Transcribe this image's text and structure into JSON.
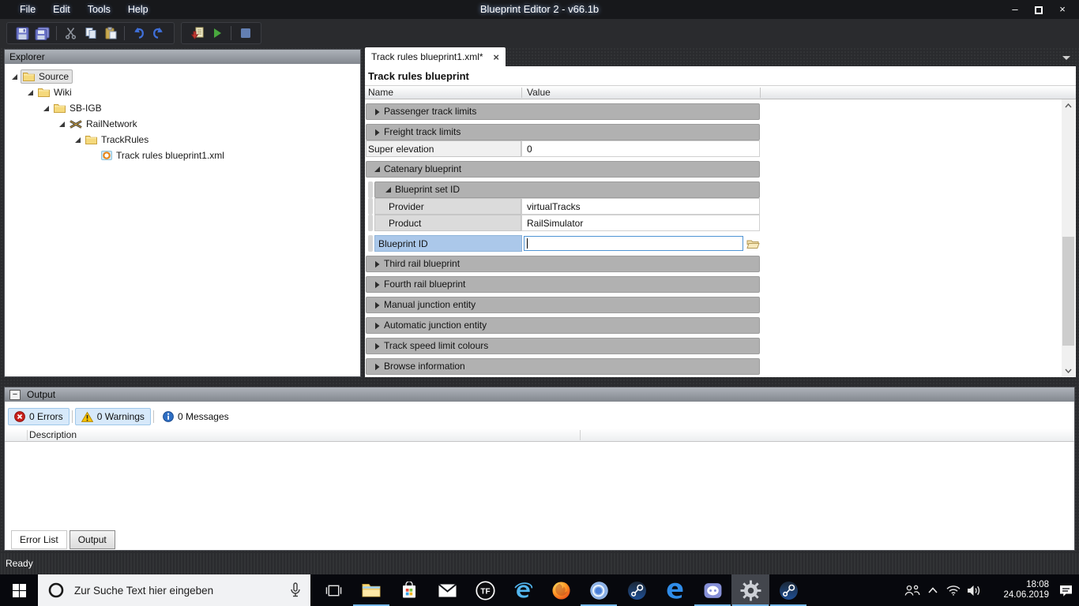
{
  "window": {
    "title": "Blueprint Editor 2 - v66.1b",
    "controls": [
      {
        "name": "minimize",
        "glyph": "–"
      },
      {
        "name": "maximize",
        "glyph": ""
      },
      {
        "name": "close",
        "glyph": "×"
      }
    ]
  },
  "menu_bar": {
    "items": [
      "File",
      "Edit",
      "Tools",
      "Help"
    ]
  },
  "toolbar": {
    "groups": [
      [
        "save",
        "save-all",
        "sep",
        "cut",
        "copy",
        "paste",
        "sep",
        "undo",
        "redo"
      ],
      [
        "export",
        "run",
        "sep",
        "stop"
      ]
    ]
  },
  "explorer": {
    "title": "Explorer",
    "tree": [
      {
        "label": "Source",
        "icon": "folder",
        "level": 0,
        "expanded": true,
        "selected": true
      },
      {
        "label": "Wiki",
        "icon": "folder",
        "level": 1,
        "expanded": true
      },
      {
        "label": "SB-IGB",
        "icon": "folder",
        "level": 2,
        "expanded": true
      },
      {
        "label": "RailNetwork",
        "icon": "rail-network",
        "level": 3,
        "expanded": true
      },
      {
        "label": "TrackRules",
        "icon": "folder",
        "level": 4,
        "expanded": true
      },
      {
        "label": "Track rules blueprint1.xml",
        "icon": "blueprint-file",
        "level": 5
      }
    ]
  },
  "editor": {
    "tab": {
      "label": "Track rules blueprint1.xml*",
      "close_glyph": "×"
    },
    "doc_title": "Track rules blueprint",
    "grid": {
      "columns": [
        "Name",
        "Value"
      ],
      "rows": [
        {
          "type": "category",
          "name": "Passenger track limits",
          "level": 0,
          "expanded": false
        },
        {
          "type": "category",
          "name": "Freight track limits",
          "level": 0,
          "expanded": false
        },
        {
          "type": "value",
          "name": "Super elevation",
          "value": "0",
          "level": 0
        },
        {
          "type": "category",
          "name": "Catenary blueprint",
          "level": 0,
          "expanded": true
        },
        {
          "type": "category",
          "name": "Blueprint set ID",
          "level": 1,
          "expanded": true
        },
        {
          "type": "value",
          "name": "Provider",
          "value": "virtualTracks",
          "level": 2
        },
        {
          "type": "value",
          "name": "Product",
          "value": "RailSimulator",
          "level": 2
        },
        {
          "type": "selected-input",
          "name": "Blueprint ID",
          "value": "",
          "level": 1,
          "browse_icon": "browse-folder"
        },
        {
          "type": "category",
          "name": "Third rail blueprint",
          "level": 0,
          "expanded": false
        },
        {
          "type": "category",
          "name": "Fourth rail blueprint",
          "level": 0,
          "expanded": false
        },
        {
          "type": "category",
          "name": "Manual junction entity",
          "level": 0,
          "expanded": false
        },
        {
          "type": "category",
          "name": "Automatic junction entity",
          "level": 0,
          "expanded": false
        },
        {
          "type": "category",
          "name": "Track speed limit colours",
          "level": 0,
          "expanded": false
        },
        {
          "type": "category",
          "name": "Browse information",
          "level": 0,
          "expanded": false
        }
      ]
    }
  },
  "output": {
    "title": "Output",
    "toggles": [
      {
        "label": "0 Errors",
        "icon": "error",
        "active": true
      },
      {
        "label": "0 Warnings",
        "icon": "warning",
        "active": true
      },
      {
        "label": "0 Messages",
        "icon": "info",
        "active": false
      }
    ],
    "description_header": "Description",
    "tabs": [
      {
        "label": "Error List",
        "active": true
      },
      {
        "label": "Output",
        "active": false
      }
    ]
  },
  "status_bar": {
    "text": "Ready"
  },
  "taskbar": {
    "search": {
      "placeholder": "Zur Suche Text hier eingeben",
      "icons": [
        "cortana",
        "microphone"
      ]
    },
    "tf_label": "TF",
    "apps": [
      {
        "name": "task-view",
        "icon": "task-view"
      },
      {
        "name": "file-explorer",
        "icon": "file-explorer",
        "underline": true
      },
      {
        "name": "microsoft-store",
        "icon": "microsoft-store"
      },
      {
        "name": "mail",
        "icon": "mail"
      },
      {
        "name": "transport-fever",
        "icon": "tf-circle"
      },
      {
        "name": "internet-explorer",
        "icon": "internet-explorer"
      },
      {
        "name": "firefox",
        "icon": "firefox"
      },
      {
        "name": "chromium",
        "icon": "chromium",
        "underline": true
      },
      {
        "name": "steam",
        "icon": "steam"
      },
      {
        "name": "edge",
        "icon": "edge"
      },
      {
        "name": "discord",
        "icon": "discord",
        "underline": true
      },
      {
        "name": "blueprint-editor-gear",
        "icon": "gear",
        "underline": true,
        "active": true
      },
      {
        "name": "steam-2",
        "icon": "steam",
        "underline": true
      }
    ],
    "tray": {
      "icons": [
        "people",
        "chevron-up",
        "wifi",
        "volume"
      ],
      "time": "18:08",
      "date": "24.06.2019",
      "action_center_icon": "action-center"
    }
  },
  "colors": {
    "selection_blue": "#abc8ea",
    "input_border": "#4f94d4",
    "category_gray": "#b1b1b1",
    "taskbar_underline": "#76b9ed",
    "toggle_active": "#d7e9fa"
  }
}
